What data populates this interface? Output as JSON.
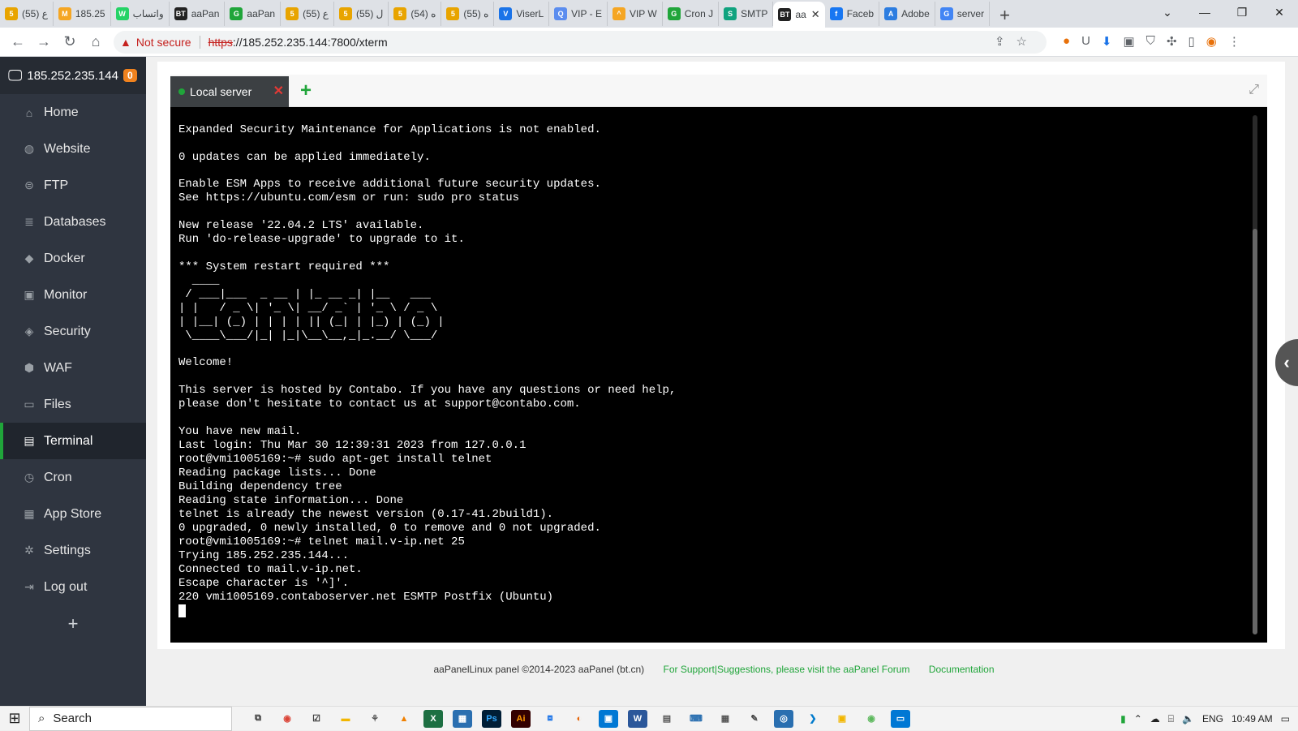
{
  "browser": {
    "tabs": [
      {
        "icon": "5",
        "color": "#e8a400",
        "label": "ع (55)"
      },
      {
        "icon": "M",
        "color": "#f5a623",
        "label": "185.25"
      },
      {
        "icon": "W",
        "color": "#25d366",
        "label": "واتساب"
      },
      {
        "icon": "BT",
        "color": "#222222",
        "label": "aaPan"
      },
      {
        "icon": "G",
        "color": "#20a53a",
        "label": "aaPan"
      },
      {
        "icon": "5",
        "color": "#e8a400",
        "label": "ع (55)"
      },
      {
        "icon": "5",
        "color": "#e8a400",
        "label": "ل (55)"
      },
      {
        "icon": "5",
        "color": "#e8a400",
        "label": "ه (54)"
      },
      {
        "icon": "5",
        "color": "#e8a400",
        "label": "ه (55)"
      },
      {
        "icon": "V",
        "color": "#1a73e8",
        "label": "ViserL"
      },
      {
        "icon": "Q",
        "color": "#5b8def",
        "label": "VIP - E"
      },
      {
        "icon": "^",
        "color": "#f5a623",
        "label": "VIP W"
      },
      {
        "icon": "G",
        "color": "#20a53a",
        "label": "Cron J"
      },
      {
        "icon": "S",
        "color": "#10a37f",
        "label": "SMTP"
      },
      {
        "icon": "BT",
        "color": "#222222",
        "label": "aa",
        "active": true
      },
      {
        "icon": "f",
        "color": "#1877f2",
        "label": "Faceb"
      },
      {
        "icon": "A",
        "color": "#2d7de0",
        "label": "Adobe"
      },
      {
        "icon": "G",
        "color": "#4285f4",
        "label": "server"
      }
    ],
    "new_tab": "+",
    "win_min": "—",
    "win_max": "❐",
    "win_close": "✕",
    "chevron": "⌄",
    "not_secure": "Not secure",
    "url_scheme": "https",
    "url_rest": "://185.252.235.144:7800/xterm"
  },
  "sidebar": {
    "host": "185.252.235.144",
    "badge": "0",
    "items": [
      {
        "label": "Home",
        "icon": "⌂"
      },
      {
        "label": "Website",
        "icon": "◍"
      },
      {
        "label": "FTP",
        "icon": "⊜"
      },
      {
        "label": "Databases",
        "icon": "≣"
      },
      {
        "label": "Docker",
        "icon": "◆"
      },
      {
        "label": "Monitor",
        "icon": "▣"
      },
      {
        "label": "Security",
        "icon": "◈"
      },
      {
        "label": "WAF",
        "icon": "⬢"
      },
      {
        "label": "Files",
        "icon": "▭"
      },
      {
        "label": "Terminal",
        "icon": "▤",
        "active": true
      },
      {
        "label": "Cron",
        "icon": "◷"
      },
      {
        "label": "App Store",
        "icon": "▦"
      },
      {
        "label": "Settings",
        "icon": "✲"
      },
      {
        "label": "Log out",
        "icon": "⇥"
      }
    ],
    "add": "+"
  },
  "terminal": {
    "tab_label": "Local server",
    "lines": [
      "Expanded Security Maintenance for Applications is not enabled.",
      "",
      "0 updates can be applied immediately.",
      "",
      "Enable ESM Apps to receive additional future security updates.",
      "See https://ubuntu.com/esm or run: sudo pro status",
      "",
      "New release '22.04.2 LTS' available.",
      "Run 'do-release-upgrade' to upgrade to it.",
      "",
      "*** System restart required ***",
      "  ____",
      " / ___|___  _ __ | |_ __ _| |__   ___",
      "| |   / _ \\| '_ \\| __/ _` | '_ \\ / _ \\",
      "| |__| (_) | | | | || (_| | |_) | (_) |",
      " \\____\\___/|_| |_|\\__\\__,_|_.__/ \\___/",
      "",
      "Welcome!",
      "",
      "This server is hosted by Contabo. If you have any questions or need help,",
      "please don't hesitate to contact us at support@contabo.com.",
      "",
      "You have new mail.",
      "Last login: Thu Mar 30 12:39:31 2023 from 127.0.0.1",
      "root@vmi1005169:~# sudo apt-get install telnet",
      "Reading package lists... Done",
      "Building dependency tree",
      "Reading state information... Done",
      "telnet is already the newest version (0.17-41.2build1).",
      "0 upgraded, 0 newly installed, 0 to remove and 0 not upgraded.",
      "root@vmi1005169:~# telnet mail.v-ip.net 25",
      "Trying 185.252.235.144...",
      "Connected to mail.v-ip.net.",
      "Escape character is '^]'.",
      "220 vmi1005169.contaboserver.net ESMTP Postfix (Ubuntu)"
    ]
  },
  "footer": {
    "copyright": "aaPanelLinux panel ©2014-2023 aaPanel (bt.cn)",
    "support_link": "For Support|Suggestions, please visit the aaPanel Forum",
    "docs_link": "Documentation"
  },
  "taskbar": {
    "search": "Search",
    "lang": "ENG",
    "time": "10:49 AM"
  }
}
